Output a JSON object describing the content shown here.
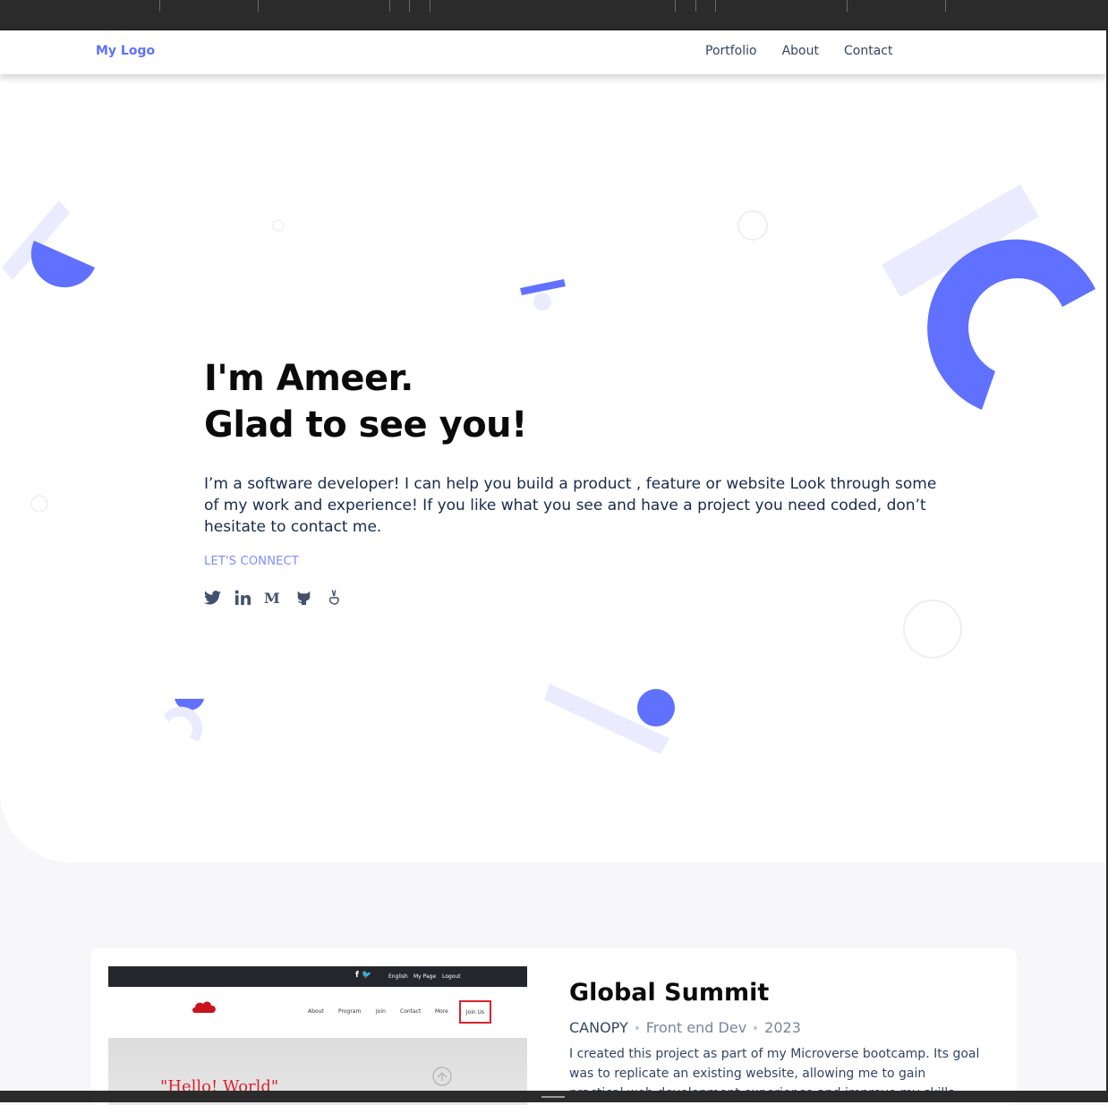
{
  "nav": {
    "logo": "My Logo",
    "links": [
      "Portfolio",
      "About",
      "Contact"
    ]
  },
  "hero": {
    "title_line1": "I'm Ameer.",
    "title_line2": "Glad to see you!",
    "intro": "I’m a software developer! I can help you build a product , feature or website Look through some of my work and experience! If you like what you see and have a project you need coded, don’t hesitate to contact me.",
    "connect_label": "LET'S CONNECT",
    "socials": [
      "twitter-icon",
      "linkedin-icon",
      "medium-icon",
      "github-icon",
      "angellist-icon"
    ]
  },
  "project": {
    "title": "Global Summit",
    "client": "CANOPY",
    "role": "Front end Dev",
    "year": "2023",
    "description": "I created this project as part of my Microverse bootcamp. Its goal was to replicate an existing website, allowing me to gain practical web development experience and improve my skills.",
    "screenshot": {
      "top_links": [
        "English",
        "My Page",
        "Logout"
      ],
      "menu": [
        "About",
        "Program",
        "Join",
        "Contact",
        "More"
      ],
      "join_label": "Join Us",
      "hero_text": "\"Hello! World\""
    }
  },
  "colors": {
    "accent": "#6070ff",
    "accent_light": "#ebebff",
    "heading": "#0b0b0b",
    "text": "#172b4d"
  }
}
